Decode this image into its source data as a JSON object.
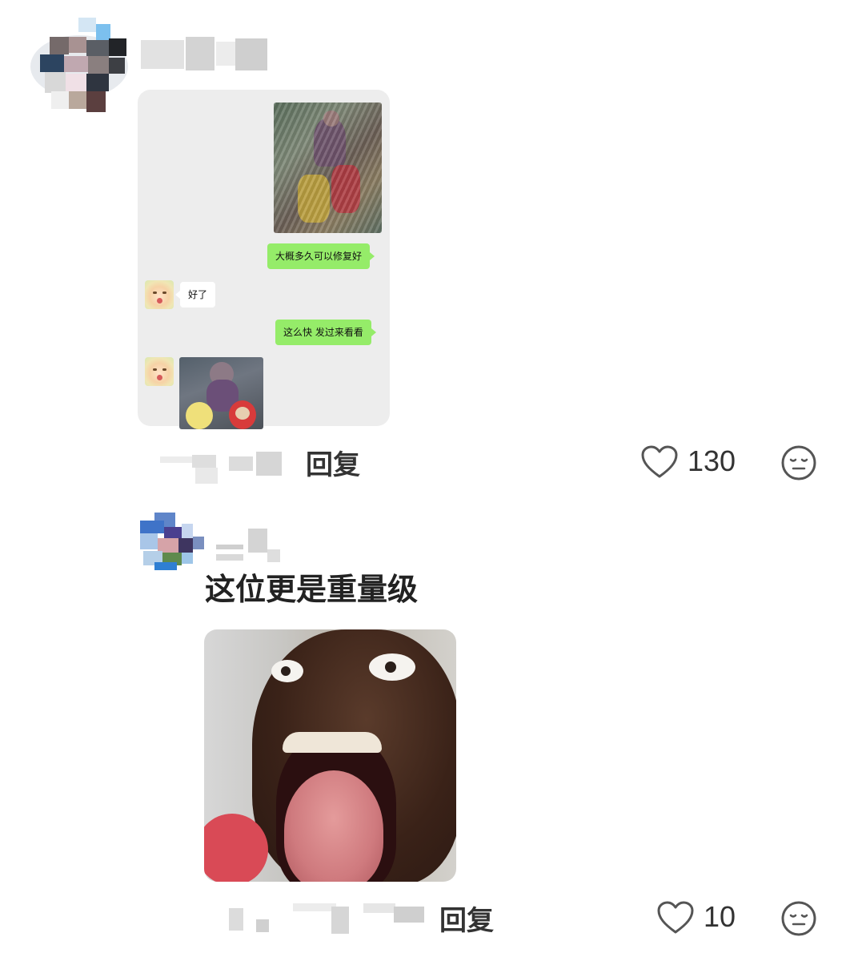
{
  "comments": [
    {
      "chat_screenshot": {
        "messages": [
          {
            "side": "right",
            "type": "image"
          },
          {
            "side": "right",
            "type": "text",
            "text": "大概多久可以修复好"
          },
          {
            "side": "left",
            "type": "text",
            "text": "好了"
          },
          {
            "side": "right",
            "type": "text",
            "text": "这么快 发过来看看"
          },
          {
            "side": "left",
            "type": "image"
          }
        ]
      },
      "reply_label": "回复",
      "likes": "130"
    },
    {
      "text": "这位更是重量级",
      "reply_label": "回复",
      "likes": "10"
    }
  ],
  "colors": {
    "bubble_green": "#95ec69",
    "chat_bg": "#ededed",
    "icon_gray": "#555555"
  },
  "icons": [
    "heart-icon",
    "expressionless-face-icon"
  ]
}
